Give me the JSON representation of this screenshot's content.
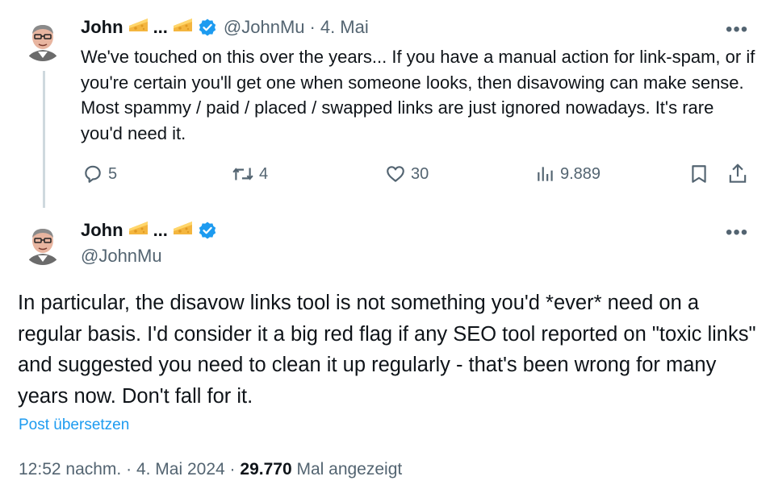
{
  "tweet1": {
    "author_name": "John",
    "name_ellipsis": "...",
    "handle": "@JohnMu",
    "separator": "·",
    "date": "4. Mai",
    "text": "We've touched on this over the years...  If you have a manual action for link-spam, or if you're certain you'll get one when someone looks, then disavowing can make sense. Most spammy / paid / placed / swapped links are just ignored nowadays. It's rare you'd need it.",
    "more_label": "•••",
    "replies": "5",
    "reposts": "4",
    "likes": "30",
    "views": "9.889"
  },
  "tweet2": {
    "author_name": "John",
    "name_ellipsis": "...",
    "handle": "@JohnMu",
    "more_label": "•••",
    "text": "In particular, the disavow links tool is not something you'd *ever* need on a regular basis. I'd consider it a big red flag if any SEO tool reported on \"toxic links\" and suggested you need to clean it up regularly - that's been wrong for many years now. Don't fall for it.",
    "translate_label": "Post übersetzen",
    "time": "12:52 nachm.",
    "separator1": "·",
    "date": "4. Mai 2024",
    "separator2": "·",
    "views_count": "29.770",
    "views_label": "Mal angezeigt"
  },
  "icons": {
    "emoji": "cheese-wedge-icon",
    "verified": "verified-badge-icon",
    "reply": "reply-bubble-icon",
    "repost": "repost-arrows-icon",
    "like": "heart-icon",
    "views": "bar-chart-icon",
    "bookmark": "bookmark-icon",
    "share": "share-upload-icon"
  },
  "colors": {
    "text": "#0f1419",
    "muted": "#536471",
    "accent": "#1d9bf0",
    "thread_line": "#cfd9de",
    "cheese": "#f4b63f"
  }
}
